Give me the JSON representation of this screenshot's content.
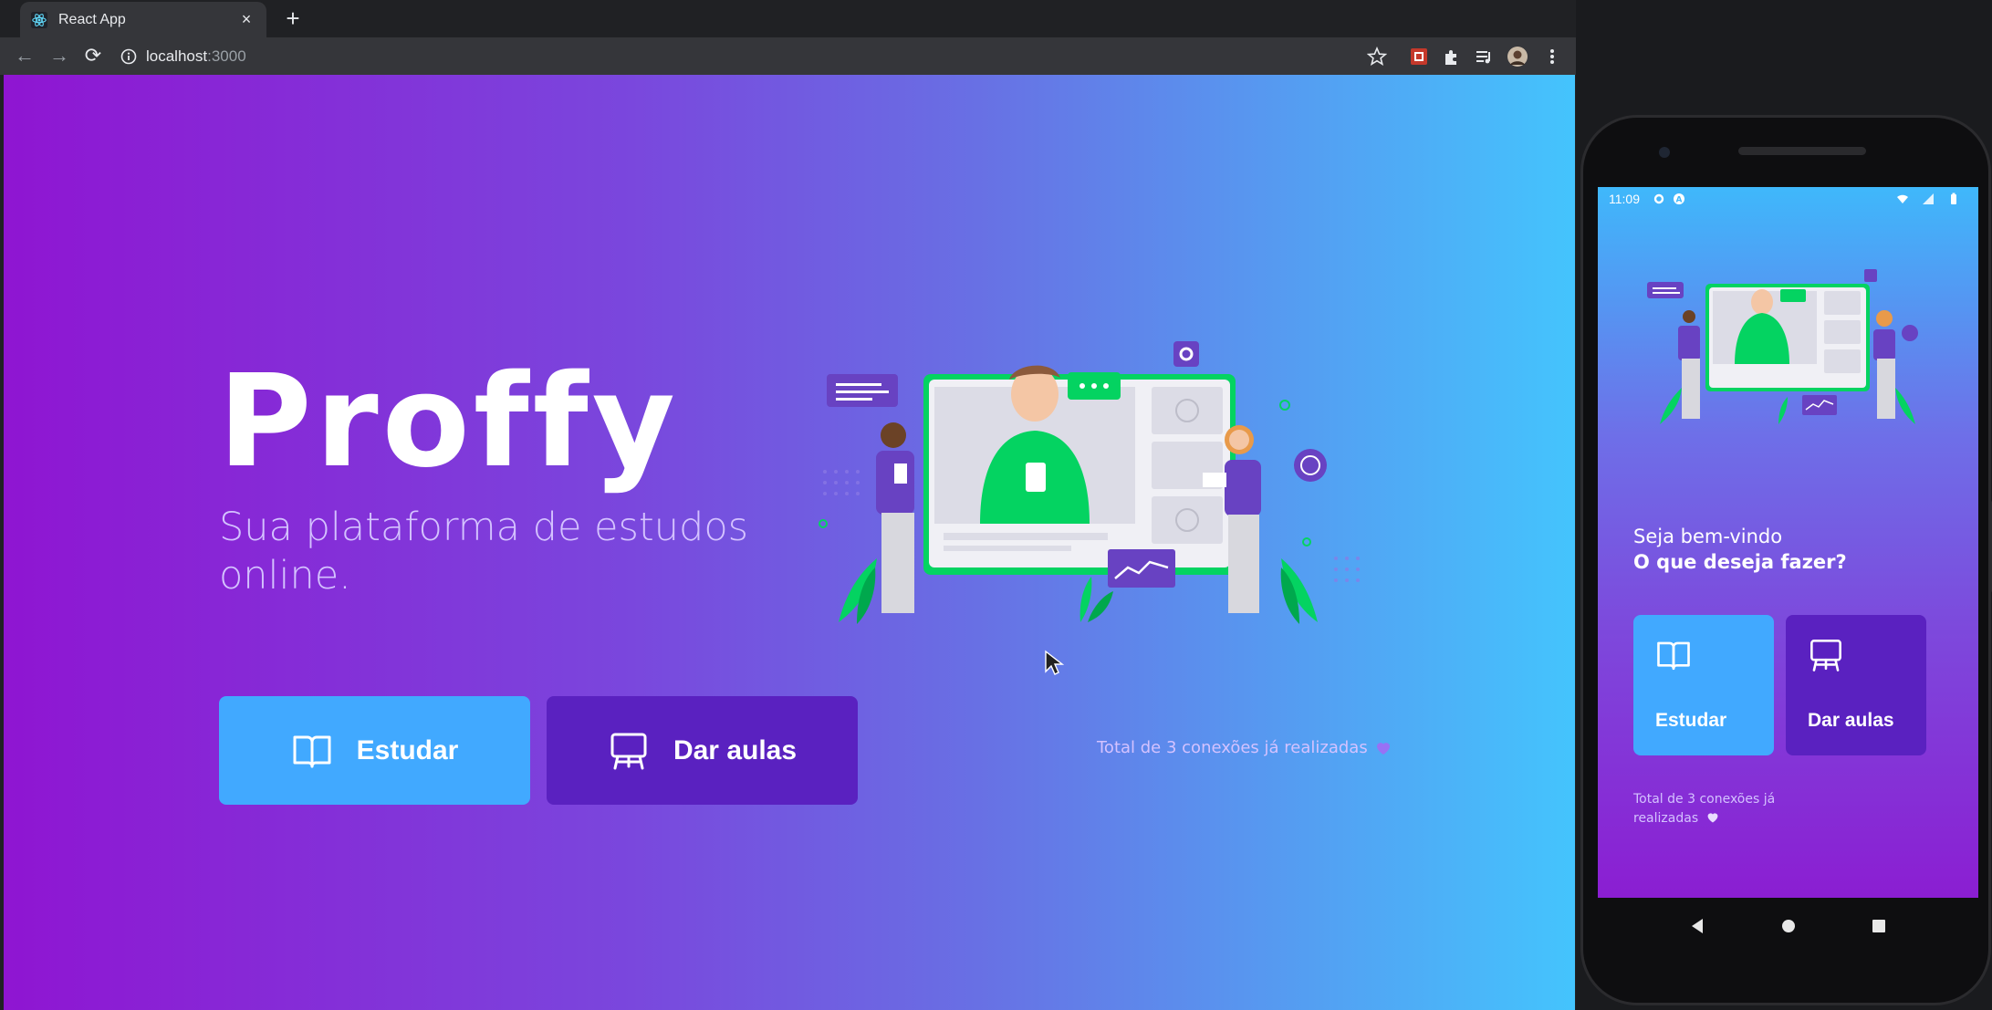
{
  "browser": {
    "tab_title": "React App",
    "tab_close": "×",
    "new_tab": "+",
    "url_host": "localhost",
    "url_port": ":3000",
    "back": "←",
    "forward": "→",
    "reload": "⟳"
  },
  "page": {
    "logo_text": "Proffy",
    "subtitle": "Sua plataforma de estudos online.",
    "buttons": {
      "study": "Estudar",
      "give_classes": "Dar aulas"
    },
    "total_connections": "Total de 3 conexões já realizadas"
  },
  "phone": {
    "status_time": "11:09",
    "welcome_line1": "Seja bem-vindo",
    "welcome_line2": "O que deseja fazer?",
    "buttons": {
      "study": "Estudar",
      "give_classes": "Dar aulas"
    },
    "total_connections": "Total de 3 conexões já realizadas"
  },
  "colors": {
    "study_button": "#41a9ff",
    "give_classes_button": "#5a21c0",
    "gradient_start": "#8f15d2",
    "gradient_end": "#44c4fd",
    "illustration_green": "#04d361",
    "heart": "#9871f5"
  },
  "icons": [
    "react-favicon",
    "info-icon",
    "star-icon",
    "extension-icon",
    "puzzle-icon",
    "playlist-icon",
    "avatar",
    "menu-dots-icon",
    "book-icon",
    "presentation-icon",
    "heart-icon"
  ]
}
